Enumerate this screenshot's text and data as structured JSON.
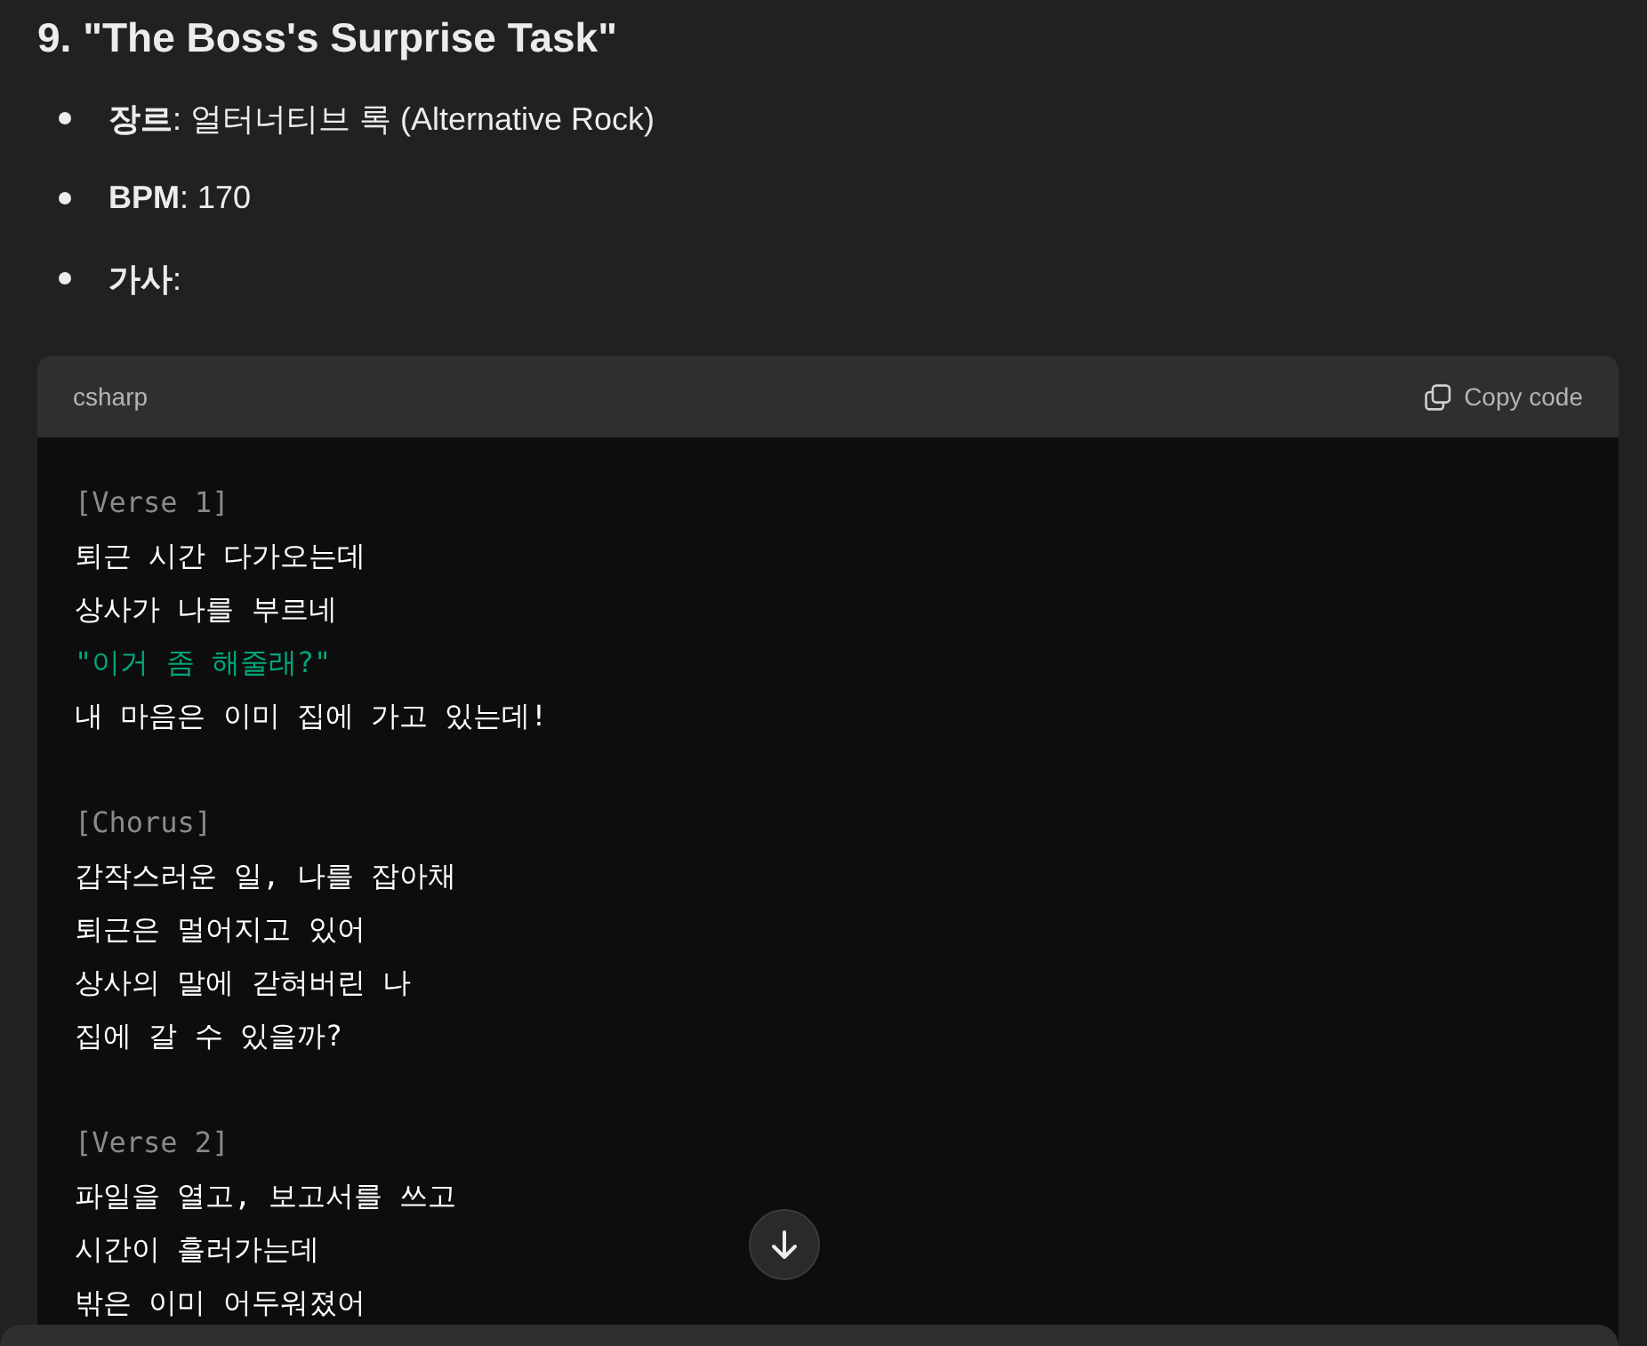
{
  "heading": "9. \"The Boss's Surprise Task\"",
  "details": [
    {
      "text": "**장르**: 얼터너티브 록 (Alternative Rock)"
    },
    {
      "text": "**BPM**: 170"
    },
    {
      "text": "**가사**:"
    }
  ],
  "code_block": {
    "language": "csharp",
    "copy_label": "Copy code",
    "stanzas": [
      {
        "label": "[Verse 1]",
        "lines": [
          {
            "kind": "plain",
            "text": "퇴근 시간 다가오는데"
          },
          {
            "kind": "plain",
            "text": "상사가 나를 부르네"
          },
          {
            "kind": "string",
            "text": "\"이거 좀 해줄래?\""
          },
          {
            "kind": "plain",
            "text": "내 마음은 이미 집에 가고 있는데!"
          }
        ]
      },
      {
        "label": "[Chorus]",
        "lines": [
          {
            "kind": "plain",
            "text": "갑작스러운 일, 나를 잡아채"
          },
          {
            "kind": "plain",
            "text": "퇴근은 멀어지고 있어"
          },
          {
            "kind": "plain",
            "text": "상사의 말에 갇혀버린 나"
          },
          {
            "kind": "plain",
            "text": "집에 갈 수 있을까?"
          }
        ]
      },
      {
        "label": "[Verse 2]",
        "lines": [
          {
            "kind": "plain",
            "text": "파일을 열고, 보고서를 쓰고"
          },
          {
            "kind": "plain",
            "text": "시간이 흘러가는데"
          },
          {
            "kind": "plain",
            "text": "밖은 이미 어두워졌어"
          }
        ]
      }
    ]
  }
}
